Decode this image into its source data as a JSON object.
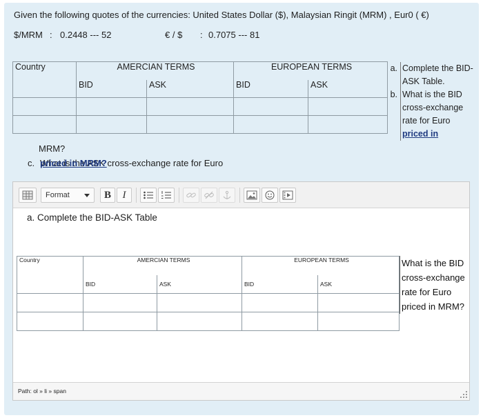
{
  "question": {
    "intro": "Given the following quotes of the currencies: United States Dollar ($), Malaysian Ringit (MRM) , Eur0 ( €)",
    "quote1_pair": "$/MRM",
    "quote1_sep": ":",
    "quote1_value": "0.2448 --- 52",
    "quote2_pair": "€ / $",
    "quote2_sep": ":",
    "quote2_value": "0.7075 --- 81",
    "table": {
      "country": "Country",
      "american": "AMERCIAN TERMS",
      "european": "EUROPEAN TERMS",
      "bid": "BID",
      "ask": "ASK"
    },
    "items": [
      {
        "marker": "a.",
        "text": "Complete the BID-ASK Table."
      },
      {
        "marker": "b.",
        "text_before": "What is the BID cross-exchange rate for Euro ",
        "text_emph": "priced in"
      }
    ],
    "continuation": "MRM?",
    "item_c_marker": "c.",
    "item_c_text": "What is the ASK cross-exchange rate for Euro ",
    "item_c_emph": "priced in MRM?"
  },
  "editor": {
    "format_label": "Format",
    "bold_label": "B",
    "italic_label": "I",
    "heading": "a. Complete the BID-ASK Table",
    "table": {
      "country": "Country",
      "american": "AMERCIAN TERMS",
      "european": "EUROPEAN TERMS",
      "bid": "BID",
      "ask": "ASK"
    },
    "side_question": "What is the BID cross-exchange rate for Euro priced in MRM?",
    "path": "Path: ol » li » span"
  }
}
